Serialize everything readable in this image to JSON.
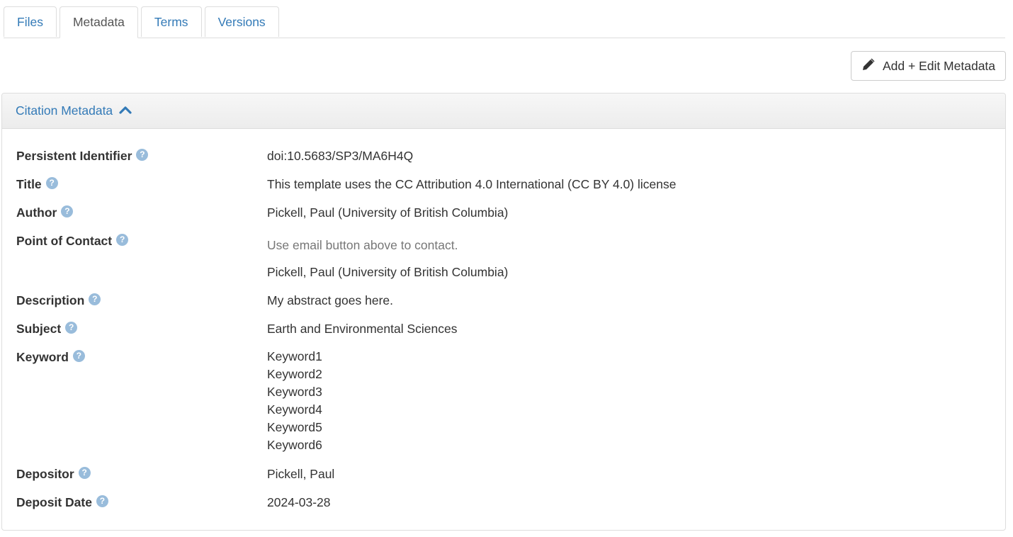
{
  "tabs": [
    {
      "label": "Files"
    },
    {
      "label": "Metadata"
    },
    {
      "label": "Terms"
    },
    {
      "label": "Versions"
    }
  ],
  "toolbar": {
    "edit_label": "Add + Edit Metadata"
  },
  "panel": {
    "heading": "Citation Metadata",
    "fields": {
      "persistent_identifier": {
        "label": "Persistent Identifier",
        "value": "doi:10.5683/SP3/MA6H4Q"
      },
      "title": {
        "label": "Title",
        "value": "This template uses the CC Attribution 4.0 International (CC BY 4.0) license"
      },
      "author": {
        "label": "Author",
        "value": "Pickell, Paul (University of British Columbia)"
      },
      "point_of_contact": {
        "label": "Point of Contact",
        "note": "Use email button above to contact.",
        "value": "Pickell, Paul (University of British Columbia)"
      },
      "description": {
        "label": "Description",
        "value": "My abstract goes here."
      },
      "subject": {
        "label": "Subject",
        "value": "Earth and Environmental Sciences"
      },
      "keyword": {
        "label": "Keyword",
        "values": [
          "Keyword1",
          "Keyword2",
          "Keyword3",
          "Keyword4",
          "Keyword5",
          "Keyword6"
        ]
      },
      "depositor": {
        "label": "Depositor",
        "value": "Pickell, Paul"
      },
      "deposit_date": {
        "label": "Deposit Date",
        "value": "2024-03-28"
      }
    }
  },
  "icons": {
    "help": "question-circle-icon",
    "edit": "pencil-icon",
    "collapse": "chevron-up-icon"
  },
  "colors": {
    "link": "#337ab7",
    "help": "#99bcdb",
    "text": "#333333",
    "muted": "#777777"
  }
}
